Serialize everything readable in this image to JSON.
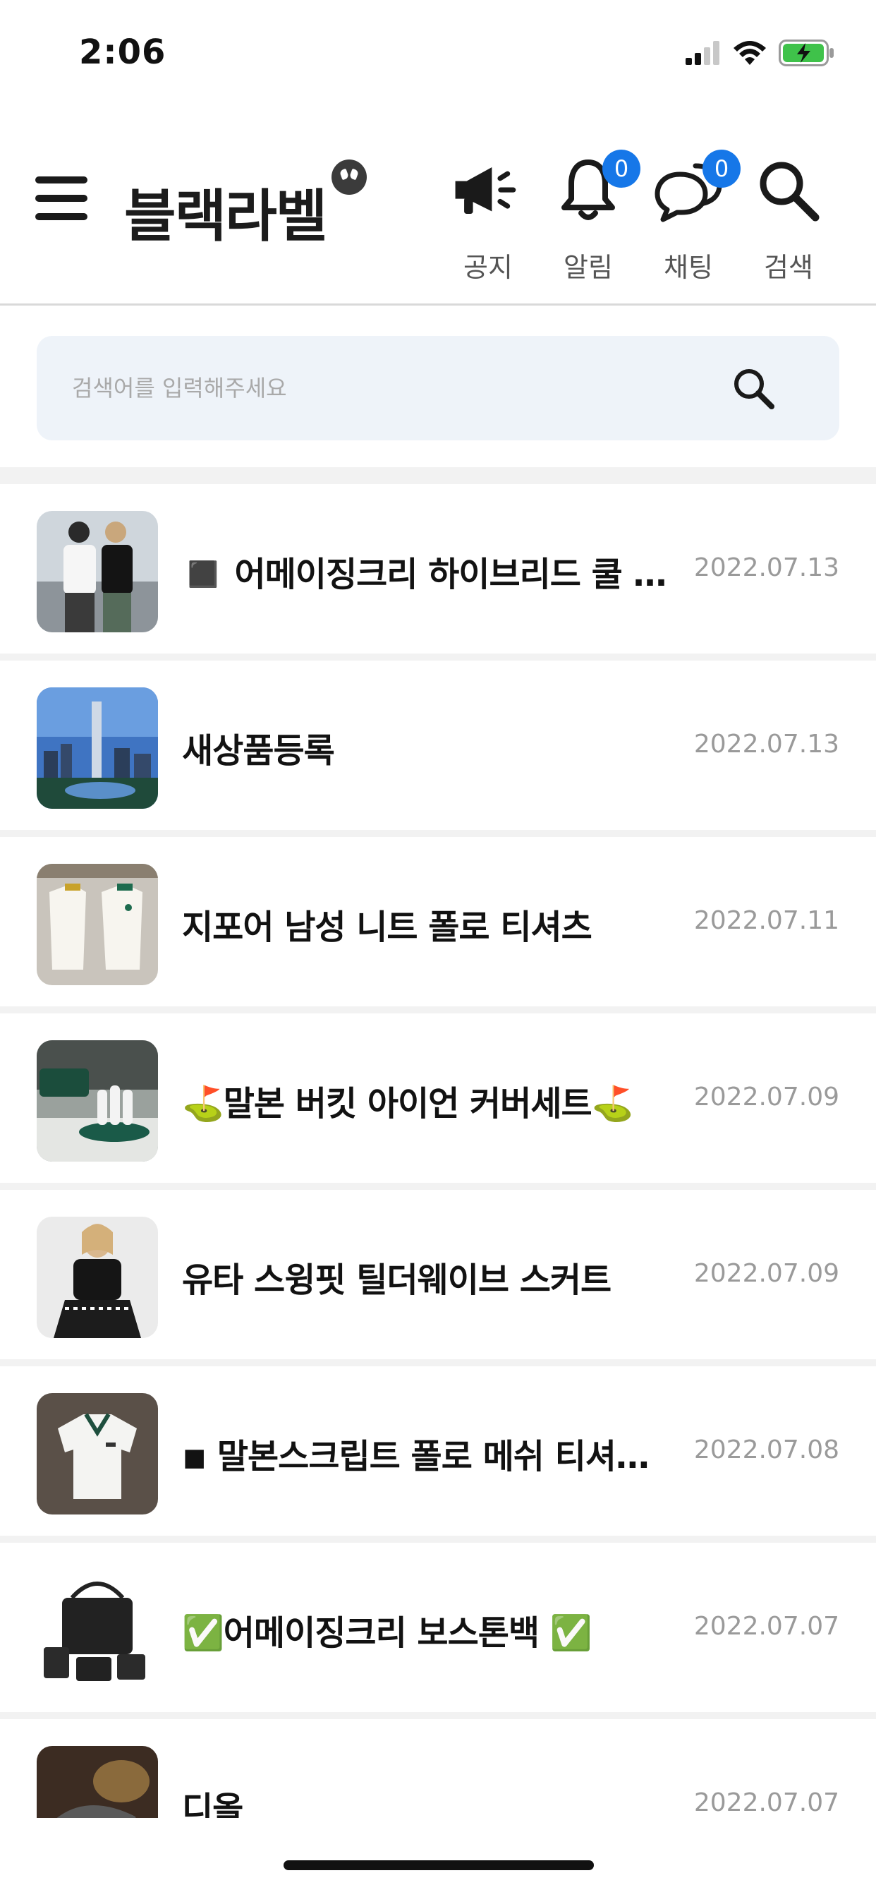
{
  "status_bar": {
    "time": "2:06",
    "icons": [
      "signal-icon",
      "wifi-icon",
      "battery-charging-icon"
    ]
  },
  "header": {
    "title": "블랙라벨",
    "nav": [
      {
        "label": "공지",
        "icon": "megaphone-icon"
      },
      {
        "label": "알림",
        "icon": "bell-icon",
        "badge": "0"
      },
      {
        "label": "채팅",
        "icon": "chat-icon",
        "badge": "0"
      },
      {
        "label": "검색",
        "icon": "search-icon"
      }
    ],
    "badge_color": "#1677e8"
  },
  "search": {
    "placeholder": "검색어를 입력해주세요",
    "value": ""
  },
  "posts": [
    {
      "title": "◼️ 어메이징크리 하이브리드 쿨 …",
      "date": "2022.07.13",
      "thumb": "golf-models-photo"
    },
    {
      "title": "새상품등록",
      "date": "2022.07.13",
      "thumb": "city-skyline-photo"
    },
    {
      "title": "지포어 남성 니트 폴로 티셔츠",
      "date": "2022.07.11",
      "thumb": "polo-shirts-photo"
    },
    {
      "title": "⛳말본 버킷 아이언 커버세트⛳",
      "date": "2022.07.09",
      "thumb": "iron-covers-photo"
    },
    {
      "title": "유타 스윙핏 틸더웨이브 스커트",
      "date": "2022.07.09",
      "thumb": "model-skirt-photo"
    },
    {
      "title": "◾ 말본스크립트 폴로 메쉬 티셔…",
      "date": "2022.07.08",
      "thumb": "white-polo-photo"
    },
    {
      "title": "✅어메이징크리 보스톤백 ✅",
      "date": "2022.07.07",
      "thumb": "boston-bag-photo"
    },
    {
      "title": "디올",
      "date": "2022.07.07",
      "thumb": "dior-shoe-photo"
    }
  ]
}
